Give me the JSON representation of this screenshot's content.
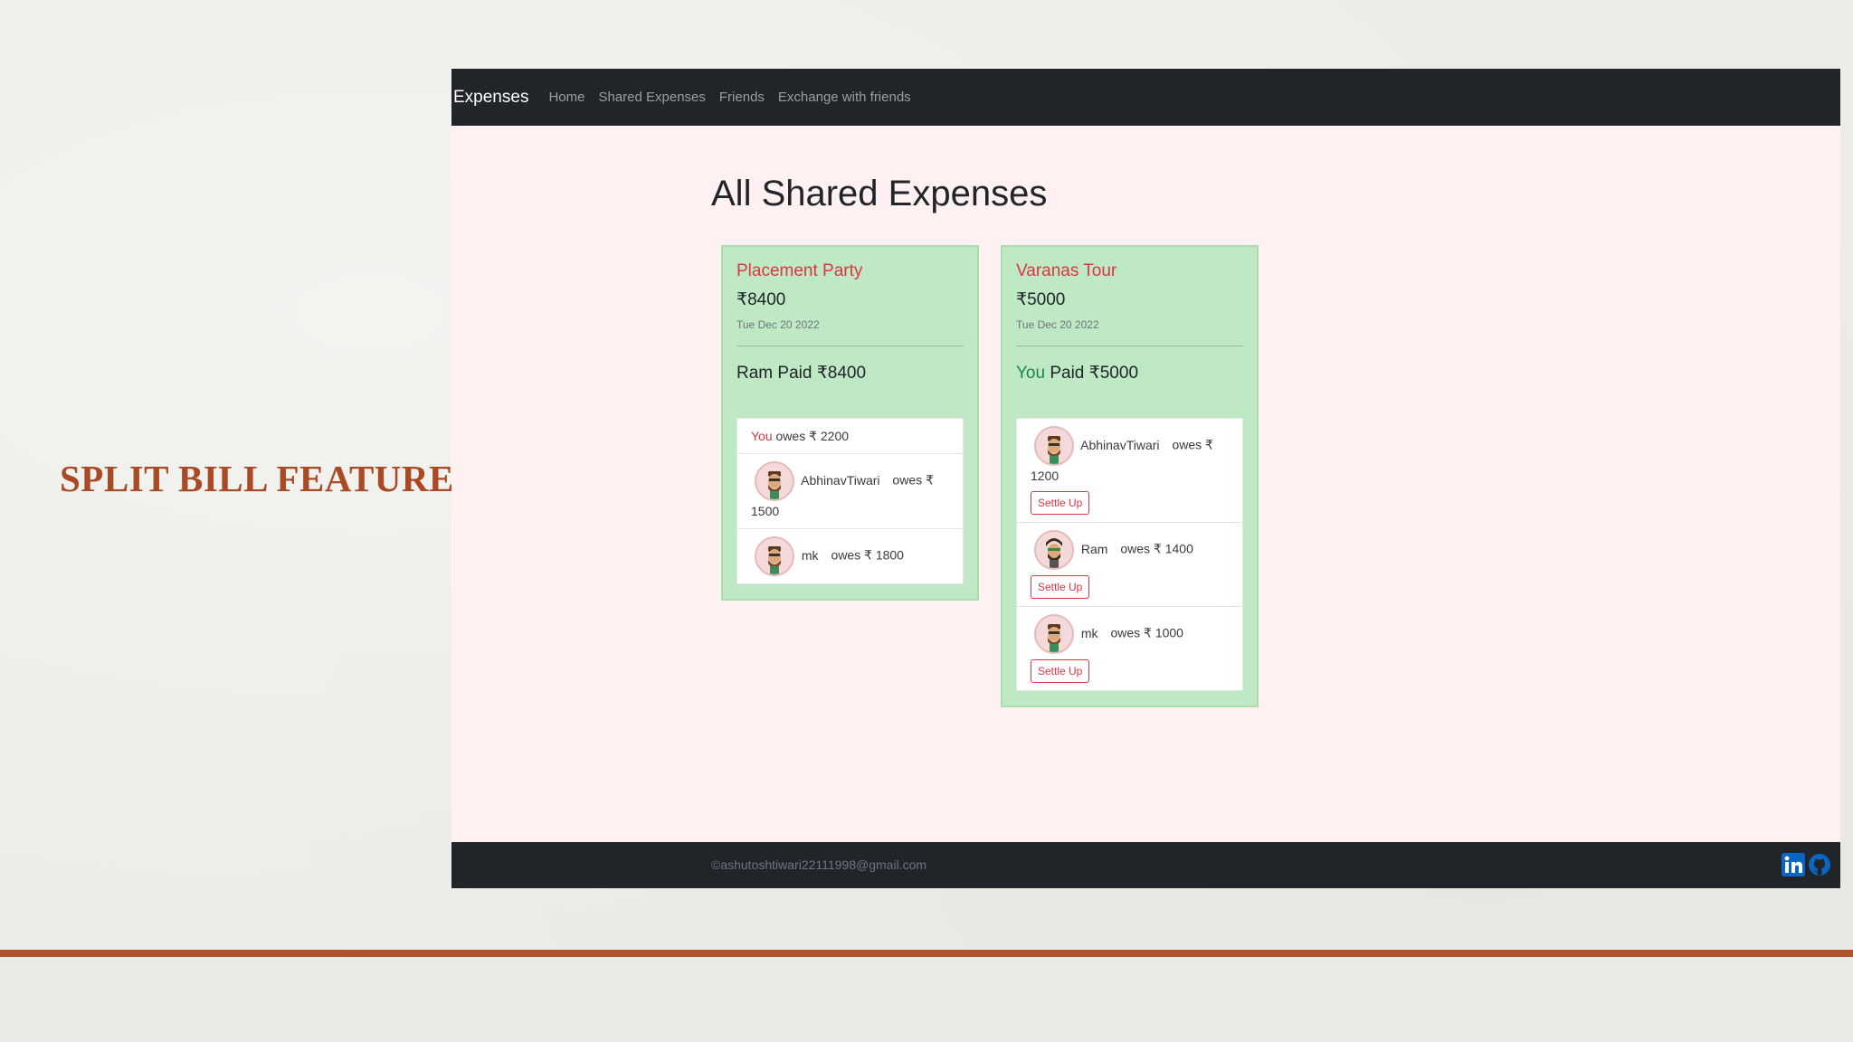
{
  "slide": {
    "title": "SPLIT BILL FEATURE"
  },
  "navbar": {
    "brand": "Expenses",
    "links": [
      "Home",
      "Shared Expenses",
      "Friends",
      "Exchange with friends"
    ]
  },
  "page": {
    "heading": "All Shared Expenses"
  },
  "cards": [
    {
      "title": "Placement Party",
      "amount": "₹8400",
      "date": "Tue Dec 20 2022",
      "payer": "Ram",
      "paid_text": "Paid ₹8400",
      "members": [
        {
          "name": "You",
          "owes": "owes ₹ 2200"
        },
        {
          "name": "AbhinavTiwari",
          "owes": "owes ₹ 1500"
        },
        {
          "name": "mk",
          "owes": "owes ₹ 1800"
        }
      ]
    },
    {
      "title": "Varanas Tour",
      "amount": "₹5000",
      "date": "Tue Dec 20 2022",
      "payer": "You",
      "paid_text": "Paid ₹5000",
      "members": [
        {
          "name": "AbhinavTiwari",
          "owes": "owes ₹ 1200",
          "action": "Settle Up"
        },
        {
          "name": "Ram",
          "owes": "owes ₹ 1400",
          "action": "Settle Up"
        },
        {
          "name": "mk",
          "owes": "owes ₹ 1000",
          "action": "Settle Up"
        }
      ]
    }
  ],
  "footer": {
    "email": "©ashutoshtiwari22111998@gmail.com",
    "icons": [
      "linkedin-icon",
      "github-icon"
    ]
  },
  "colors": {
    "navbar": "#212529",
    "card_bg": "#bfe8c4",
    "accent_red": "#dc3545",
    "you_green": "#198754",
    "page_bg": "#fff0f1",
    "slide_title": "#a94a25"
  }
}
